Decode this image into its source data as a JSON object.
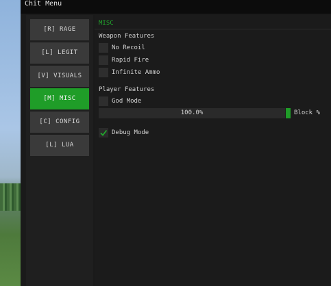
{
  "window": {
    "title": "Chit Menu"
  },
  "sidebar": {
    "tabs": [
      {
        "label": "[R]  RAGE",
        "active": false
      },
      {
        "label": "[L]  LEGIT",
        "active": false
      },
      {
        "label": "[V]  VISUALS",
        "active": false
      },
      {
        "label": "[M]  MISC",
        "active": true
      },
      {
        "label": "[C]  CONFIG",
        "active": false
      },
      {
        "label": "[L]  LUA",
        "active": false
      }
    ]
  },
  "content": {
    "header": "MISC",
    "weapon_section": {
      "title": "Weapon Features",
      "options": [
        {
          "label": "No Recoil",
          "checked": false
        },
        {
          "label": "Rapid Fire",
          "checked": false
        },
        {
          "label": "Infinite Ammo",
          "checked": false
        }
      ]
    },
    "player_section": {
      "title": "Player Features",
      "god_mode": {
        "label": "God Mode",
        "checked": false
      },
      "slider": {
        "value_text": "100.0%",
        "label": "Block %",
        "value": 100
      }
    },
    "debug": {
      "label": "Debug Mode",
      "checked": true
    }
  },
  "colors": {
    "accent": "#1f9d28",
    "panel": "#1b1b1b",
    "tab": "#3a3a3a",
    "titlebar": "#0c0c0c"
  }
}
